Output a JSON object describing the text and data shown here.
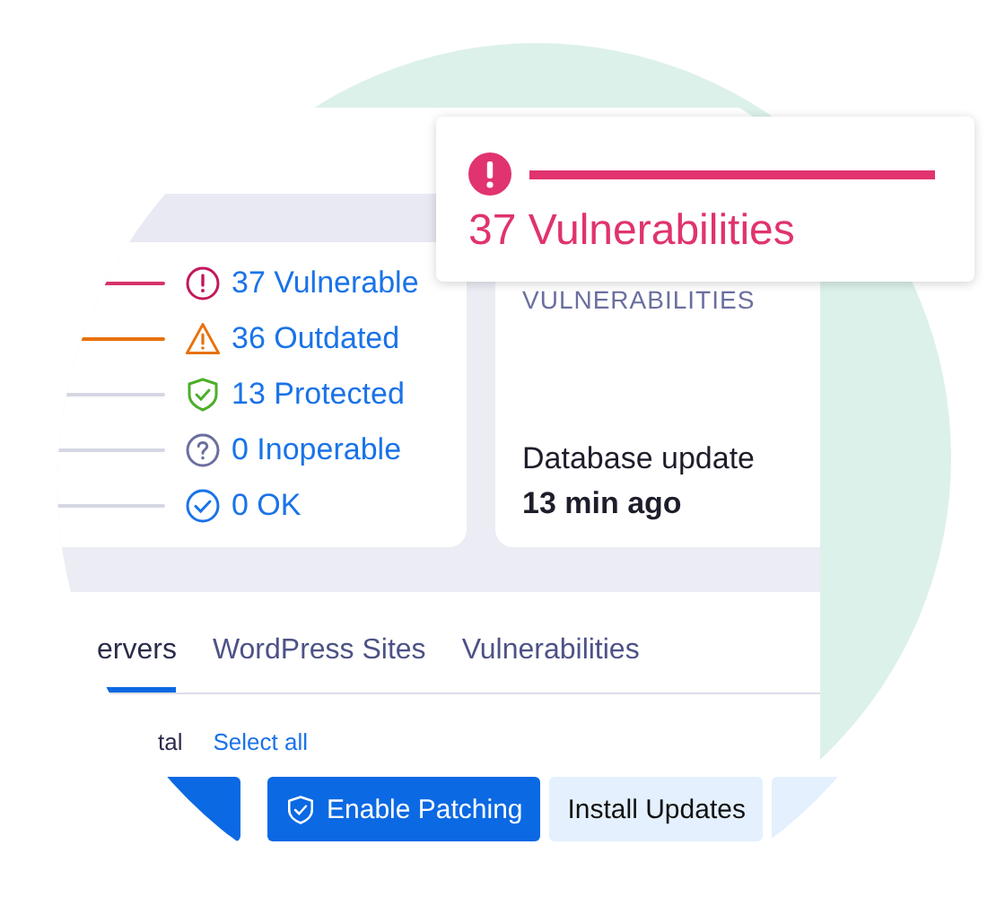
{
  "popup": {
    "title": "37 Vulnerabilities"
  },
  "status_card": {
    "items": [
      {
        "label": "37 Vulnerable",
        "kind": "vulnerable",
        "color": "#d6336c"
      },
      {
        "label": "36 Outdated",
        "kind": "outdated",
        "color": "#e8710a"
      },
      {
        "label": "13 Protected",
        "kind": "protected",
        "color": "#d5d7e3"
      },
      {
        "label": "0 Inoperable",
        "kind": "inoperable",
        "color": "#d5d7e3"
      },
      {
        "label": "0 OK",
        "kind": "ok",
        "color": "#d5d7e3"
      }
    ]
  },
  "vulnerabilities_card": {
    "heading": "VULNERABILITIES",
    "update_label": "Database update",
    "update_time": "13 min ago"
  },
  "tabs": [
    {
      "label": "ervers",
      "selected": true
    },
    {
      "label": "WordPress Sites",
      "selected": false
    },
    {
      "label": "Vulnerabilities",
      "selected": false
    }
  ],
  "selection": {
    "total_label": "tal",
    "select_all": "Select all"
  },
  "buttons": [
    {
      "kind": "primary"
    },
    {
      "kind": "primary",
      "label": "Enable Patching",
      "icon": true
    },
    {
      "kind": "secondary",
      "label": "Install Updates"
    },
    {
      "kind": "secondary"
    }
  ]
}
